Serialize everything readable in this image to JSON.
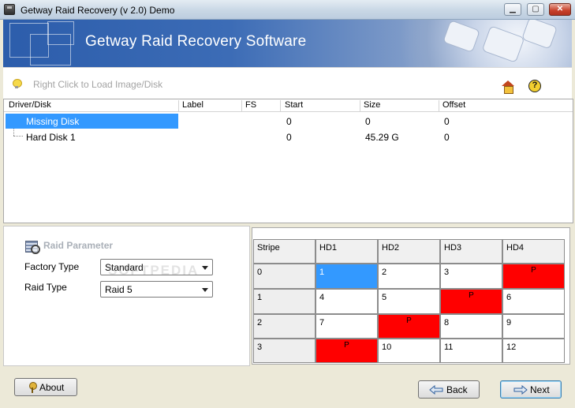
{
  "window": {
    "title": "Getway Raid Recovery (v 2.0) Demo",
    "minimize_glyph": "▁",
    "maximize_glyph": "▢",
    "close_glyph": "✕"
  },
  "banner": {
    "title": "Getway Raid Recovery Software"
  },
  "toolbar": {
    "hint": "Right Click to Load Image/Disk",
    "help_glyph": "?",
    "icons": [
      "bulb-icon",
      "home-icon",
      "help-icon"
    ]
  },
  "disk_list": {
    "columns": [
      "Driver/Disk",
      "Label",
      "FS",
      "Start",
      "Size",
      "Offset"
    ],
    "rows": [
      {
        "name": "Missing Disk",
        "label": "",
        "fs": "",
        "start": "0",
        "size": "0",
        "offset": "0",
        "selected": true
      },
      {
        "name": "Hard Disk 1",
        "label": "",
        "fs": "",
        "start": "0",
        "size": "45.29 G",
        "offset": "0",
        "selected": false
      }
    ]
  },
  "raid_parameter": {
    "title": "Raid Parameter",
    "factory_type_label": "Factory Type",
    "factory_type_value": "Standard",
    "raid_type_label": "Raid Type",
    "raid_type_value": "Raid 5",
    "watermark": "SOFTPEDIA"
  },
  "stripe_grid": {
    "headers": [
      "Stripe",
      "HD1",
      "HD2",
      "HD3",
      "HD4"
    ],
    "rows": [
      {
        "stripe": "0",
        "cells": [
          "1",
          "2",
          "3",
          "P"
        ]
      },
      {
        "stripe": "1",
        "cells": [
          "4",
          "5",
          "P",
          "6"
        ]
      },
      {
        "stripe": "2",
        "cells": [
          "7",
          "P",
          "8",
          "9"
        ]
      },
      {
        "stripe": "3",
        "cells": [
          "P",
          "10",
          "11",
          "12"
        ]
      }
    ],
    "colors": {
      "parity": "#ff0000",
      "selected": "#3399ff"
    }
  },
  "buttons": {
    "about": "About",
    "back": "Back",
    "next": "Next"
  }
}
